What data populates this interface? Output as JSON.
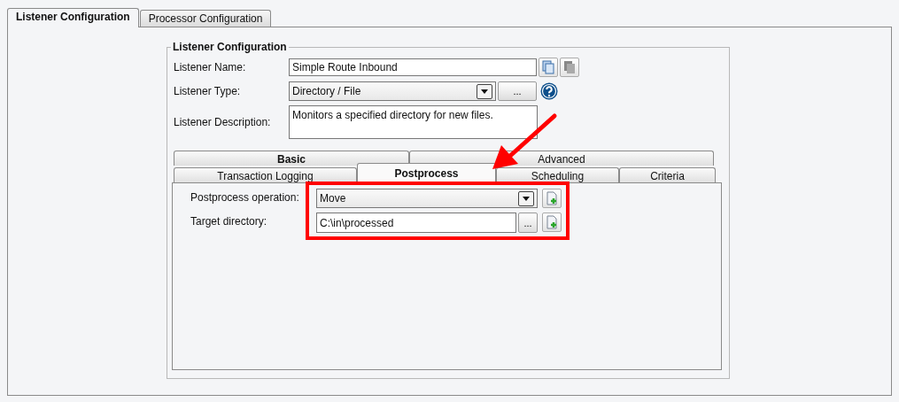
{
  "tabs": [
    {
      "label": "Listener Configuration",
      "selected": true
    },
    {
      "label": "Processor Configuration",
      "selected": false
    }
  ],
  "group": {
    "title": "Listener Configuration",
    "name": {
      "label": "Listener Name:",
      "value": "Simple Route Inbound"
    },
    "type": {
      "label": "Listener Type:",
      "value": "Directory / File",
      "browse": "..."
    },
    "description": {
      "label": "Listener Description:",
      "value": "Monitors a specified directory for new files."
    }
  },
  "inner_tabs": [
    [
      {
        "label": "Basic",
        "selected": false,
        "bold": true
      },
      {
        "label": "Advanced",
        "selected": false,
        "bold": false
      }
    ],
    [
      {
        "label": "Transaction Logging",
        "selected": false,
        "bold": false
      },
      {
        "label": "Postprocess",
        "selected": true,
        "bold": true
      },
      {
        "label": "Scheduling",
        "selected": false,
        "bold": false
      },
      {
        "label": "Criteria",
        "selected": false,
        "bold": false
      }
    ]
  ],
  "postprocess": {
    "operation": {
      "label": "Postprocess operation:",
      "value": "Move"
    },
    "target": {
      "label": "Target directory:",
      "value": "C:\\in\\processed",
      "browse": "..."
    }
  }
}
